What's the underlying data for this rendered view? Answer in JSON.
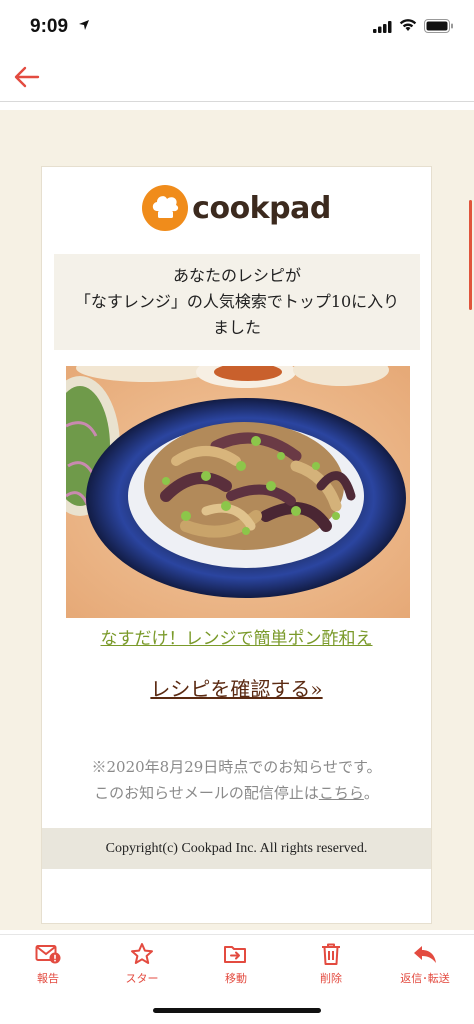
{
  "status_bar": {
    "time": "9:09"
  },
  "logo": {
    "text": "cookpad"
  },
  "notice": {
    "line1": "あなたのレシピが",
    "line2": "「なすレンジ」の人気検索でトップ10に入り",
    "line3": "ました"
  },
  "recipe": {
    "title": "なすだけ！レンジで簡単ポン酢和え",
    "confirm_label": "レシピを確認する»"
  },
  "footnote": {
    "line1": "※2020年8月29日時点でのお知らせです。",
    "line2_prefix": "このお知らせメールの配信停止は",
    "unsubscribe_link": "こちら",
    "line2_suffix": "。"
  },
  "copyright": "Copyright(c) Cookpad Inc. All rights reserved.",
  "toolbar": {
    "items": [
      {
        "label": "報告",
        "icon": "report-mail-icon"
      },
      {
        "label": "スター",
        "icon": "star-icon"
      },
      {
        "label": "移動",
        "icon": "move-folder-icon"
      },
      {
        "label": "削除",
        "icon": "trash-icon"
      },
      {
        "label": "返信･転送",
        "icon": "reply-icon"
      }
    ]
  },
  "colors": {
    "accent": "#e34b40",
    "brand_orange": "#f08c1b",
    "link_green": "#7a9a2a",
    "confirm_brown": "#5b2a12",
    "mail_background": "#f6f1e4"
  }
}
